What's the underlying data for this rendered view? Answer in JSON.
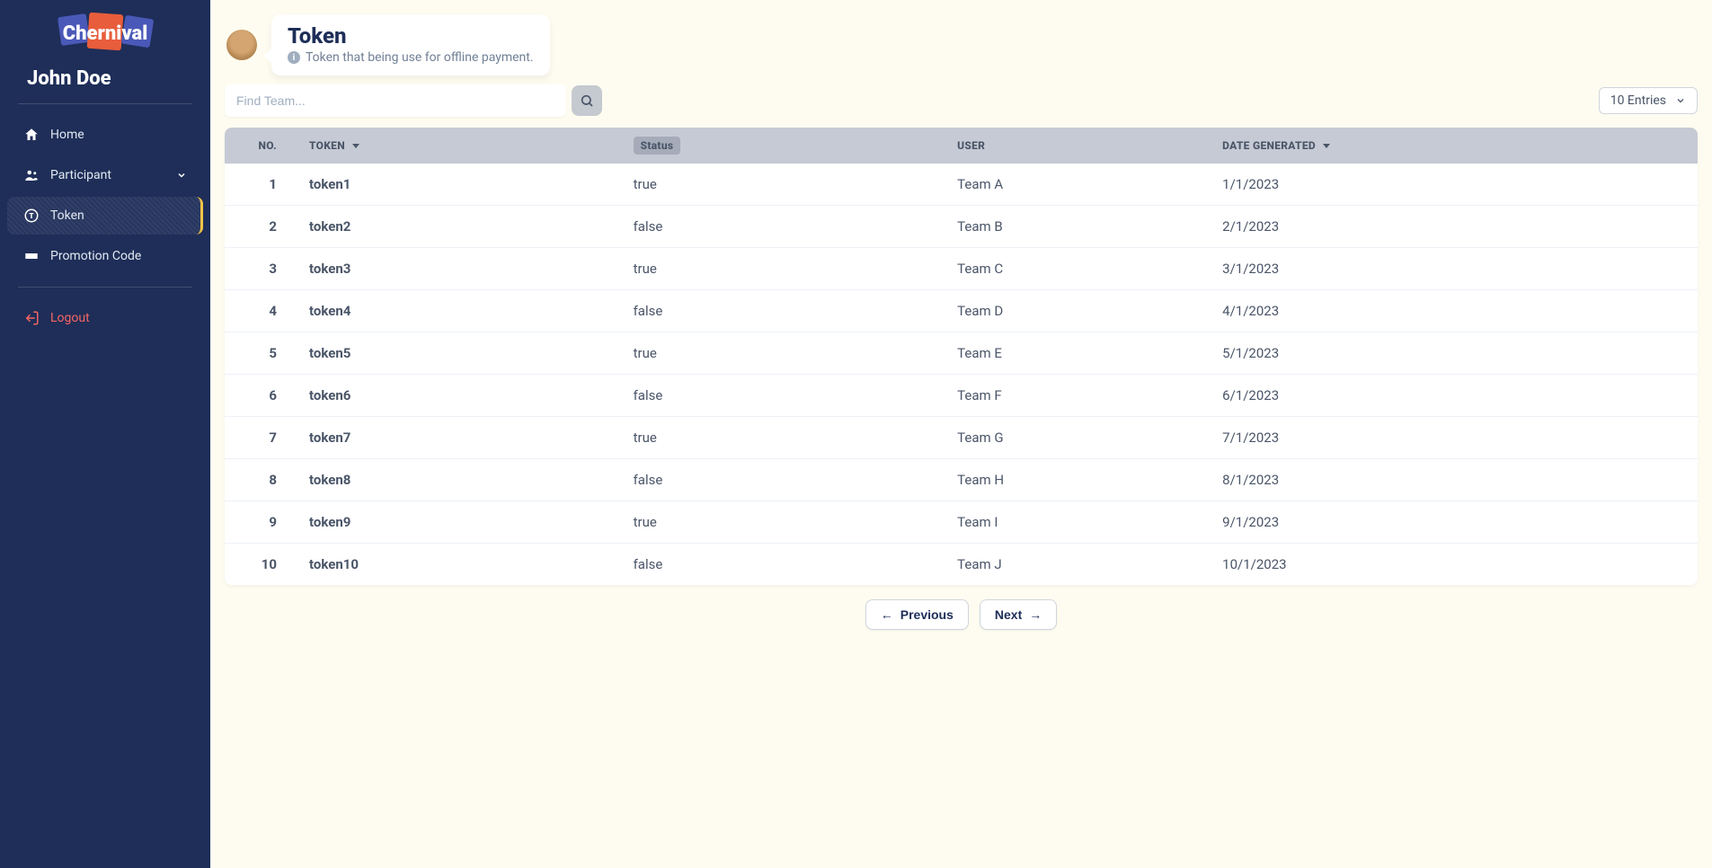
{
  "app": {
    "name": "Chernival"
  },
  "user": {
    "name": "John Doe"
  },
  "sidebar": {
    "items": [
      {
        "label": "Home",
        "icon": "home-icon"
      },
      {
        "label": "Participant",
        "icon": "participant-icon",
        "expandable": true
      },
      {
        "label": "Token",
        "icon": "token-icon",
        "active": true
      },
      {
        "label": "Promotion Code",
        "icon": "ticket-icon"
      }
    ],
    "logout_label": "Logout"
  },
  "header": {
    "title": "Token",
    "subtitle": "Token that being use for offline payment."
  },
  "search": {
    "placeholder": "Find Team..."
  },
  "entries": {
    "label": "10 Entries"
  },
  "table": {
    "columns": {
      "no": "NO.",
      "token": "TOKEN",
      "status": "Status",
      "user": "USER",
      "date": "DATE GENERATED"
    },
    "rows": [
      {
        "no": "1",
        "token": "token1",
        "status": "true",
        "user": "Team A",
        "date": "1/1/2023"
      },
      {
        "no": "2",
        "token": "token2",
        "status": "false",
        "user": "Team B",
        "date": "2/1/2023"
      },
      {
        "no": "3",
        "token": "token3",
        "status": "true",
        "user": "Team C",
        "date": "3/1/2023"
      },
      {
        "no": "4",
        "token": "token4",
        "status": "false",
        "user": "Team D",
        "date": "4/1/2023"
      },
      {
        "no": "5",
        "token": "token5",
        "status": "true",
        "user": "Team E",
        "date": "5/1/2023"
      },
      {
        "no": "6",
        "token": "token6",
        "status": "false",
        "user": "Team F",
        "date": "6/1/2023"
      },
      {
        "no": "7",
        "token": "token7",
        "status": "true",
        "user": "Team G",
        "date": "7/1/2023"
      },
      {
        "no": "8",
        "token": "token8",
        "status": "false",
        "user": "Team H",
        "date": "8/1/2023"
      },
      {
        "no": "9",
        "token": "token9",
        "status": "true",
        "user": "Team I",
        "date": "9/1/2023"
      },
      {
        "no": "10",
        "token": "token10",
        "status": "false",
        "user": "Team J",
        "date": "10/1/2023"
      }
    ]
  },
  "pagination": {
    "previous": "Previous",
    "next": "Next"
  }
}
